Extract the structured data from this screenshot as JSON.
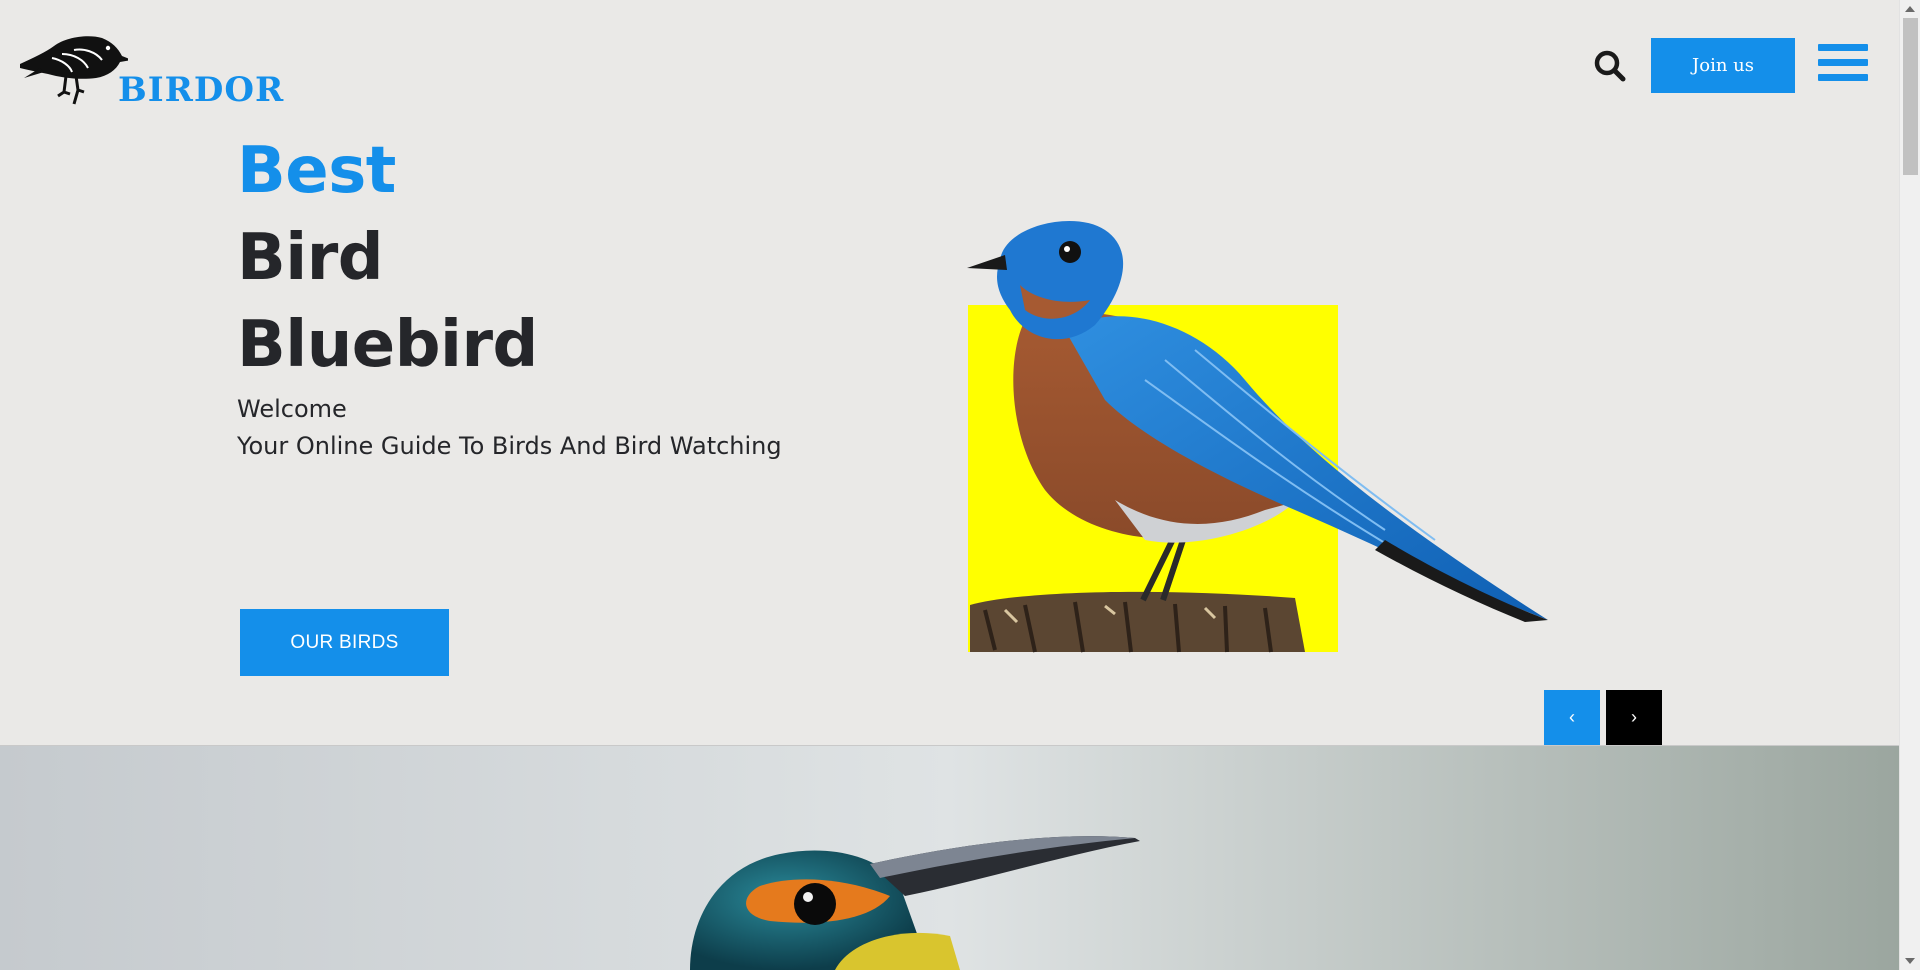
{
  "header": {
    "logo_text": "BIRDOR",
    "join_label": "Join us",
    "search_icon": "search-icon",
    "menu_icon": "hamburger-menu-icon"
  },
  "hero": {
    "line1": "Best",
    "line2": "Bird",
    "line3": "Bluebird",
    "subtitle1": "Welcome",
    "subtitle2": "Your Online Guide To Birds And Bird Watching",
    "cta_label": "OUR BIRDS",
    "prev_label": "‹",
    "next_label": "›"
  },
  "colors": {
    "accent": "#148fea",
    "background": "#eae9e7",
    "text": "#25262a",
    "highlight_square": "#ffff00"
  }
}
